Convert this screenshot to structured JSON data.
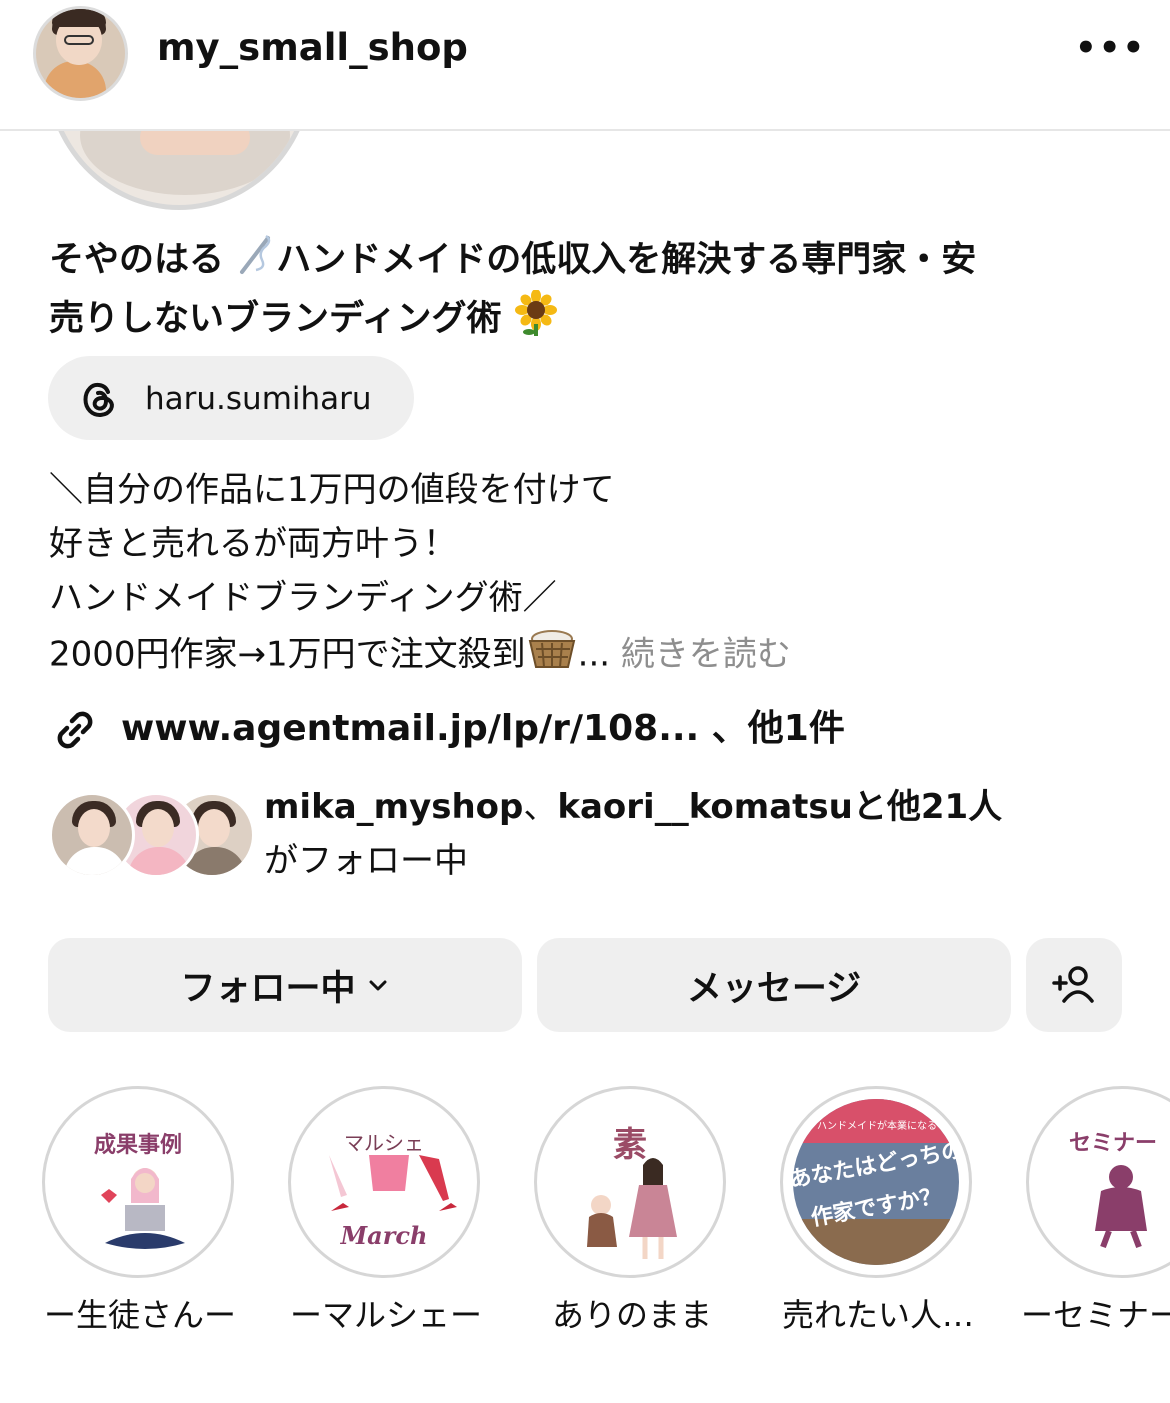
{
  "header": {
    "username": "my_small_shop",
    "more_icon": "more-horizontal-icon",
    "more_glyph": "•••"
  },
  "profile": {
    "name_line1": "そやのはる",
    "name_line1_rest": "ハンドメイドの低収入を解決する専門家・安",
    "name_line2": "売りしないブランディング術",
    "threads": {
      "icon": "threads-icon",
      "handle": "haru.sumiharu"
    },
    "bio": {
      "line1": "＼自分の作品に1万円の値段を付けて",
      "line2": "好きと売れるが両方叶う！",
      "line3": "ハンドメイドブランディング術／",
      "line4": "2000円作家→1万円で注文殺到",
      "ellipsis": "...",
      "more": "続きを読む"
    },
    "link": {
      "icon": "link-icon",
      "url": "www.agentmail.jp/lp/r/108...",
      "extra": "、他1件"
    },
    "followed_by": {
      "user1": "mika_myshop",
      "sep": "、",
      "user2": "kaori__komatsu",
      "others": "と他21人",
      "line2": "がフォロー中"
    }
  },
  "actions": {
    "follow_label": "フォロー中",
    "message_label": "メッセージ",
    "add_user_icon": "add-user-icon"
  },
  "highlights": [
    {
      "title": "成果事例",
      "label": "ー生徒さんー"
    },
    {
      "title": "マルシェ",
      "sub": "March",
      "label": "ーマルシェー"
    },
    {
      "title": "素",
      "label": "ありのまま"
    },
    {
      "title_top": "ハンドメイドが本業になる",
      "title": "あなたはどっちの",
      "title2": "作家ですか？",
      "label": "売れたい人…"
    },
    {
      "title": "セミナー",
      "label": "ーセミナー"
    }
  ]
}
